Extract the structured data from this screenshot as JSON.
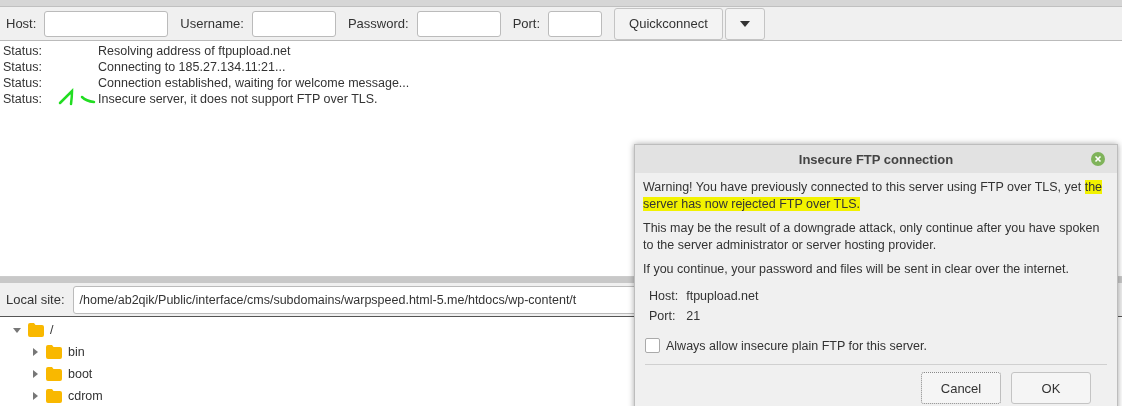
{
  "toolbar": {
    "fields": [
      {
        "label": "Host:"
      },
      {
        "label": "Username:"
      },
      {
        "label": "Password:"
      },
      {
        "label": "Port:"
      }
    ],
    "quickconnect": "Quickconnect"
  },
  "log": [
    {
      "kind": "Status:",
      "message": "Resolving address of ftpupload.net"
    },
    {
      "kind": "Status:",
      "message": "Connecting to 185.27.134.11:21..."
    },
    {
      "kind": "Status:",
      "message": "Connection established, waiting for welcome message..."
    },
    {
      "kind": "Status:",
      "message": "Insecure server, it does not support FTP over TLS."
    }
  ],
  "local_site": {
    "label": "Local site:",
    "value": "/home/ab2qik/Public/interface/cms/subdomains/warpspeed.html-5.me/htdocs/wp-content/t"
  },
  "tree": [
    {
      "name": "/",
      "expanded": true,
      "children": [
        {
          "name": "bin",
          "expanded": false
        },
        {
          "name": "boot",
          "expanded": false
        },
        {
          "name": "cdrom",
          "expanded": false
        }
      ]
    }
  ],
  "dialog": {
    "title": "Insecure FTP connection",
    "paragraphs": [
      [
        {
          "text": "Warning! You have previously connected to this server using FTP over TLS, yet ",
          "highlighted": false
        },
        {
          "text": "the server has now rejected FTP over TLS.",
          "highlighted": true
        }
      ],
      [
        {
          "text": "This may be the result of a downgrade attack, only continue after you have spoken to the server administrator or server hosting provider.",
          "highlighted": false
        }
      ],
      [
        {
          "text": "If you continue, your password and files will be sent in clear over the internet.",
          "highlighted": false
        }
      ]
    ],
    "details": [
      {
        "label": "Host:",
        "value": "ftpupload.net"
      },
      {
        "label": "Port:",
        "value": "21"
      }
    ],
    "checkbox": {
      "label": "Always allow insecure plain FTP for this server.",
      "checked": false
    },
    "buttons": [
      {
        "label": "Cancel",
        "focused": true
      },
      {
        "label": "OK",
        "focused": false
      }
    ]
  }
}
